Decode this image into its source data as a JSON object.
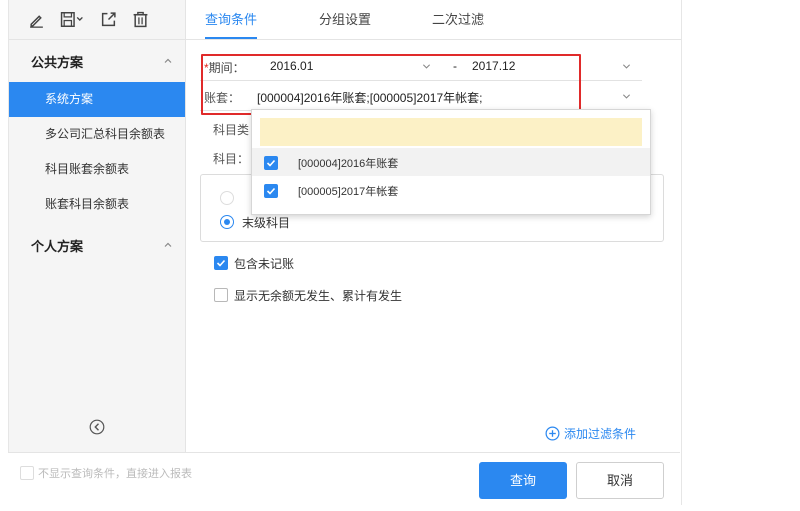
{
  "toolbar": {
    "icons": [
      "edit-icon",
      "save-icon",
      "export-icon",
      "delete-icon"
    ]
  },
  "sidebar": {
    "public_title": "公共方案",
    "public_items": [
      "系统方案",
      "多公司汇总科目余额表",
      "科目账套余额表",
      "账套科目余额表"
    ],
    "private_title": "个人方案"
  },
  "tabs": [
    "查询条件",
    "分组设置",
    "二次过滤"
  ],
  "form": {
    "period_required": "*",
    "period_label": "期间：",
    "period_from": "2016.01",
    "period_sep": "-",
    "period_to": "2017.12",
    "book_label": "账套：",
    "book_value": "[000004]2016年账套;[000005]2017年帐套;",
    "subject_type_label": "科目类",
    "subject_label": "科目：",
    "radio_leaf": "末级科目",
    "include_unposted": "包含未记账",
    "show_no_balance": "显示无余额无发生、累计有发生"
  },
  "dropdown": {
    "items": [
      "[000004]2016年账套",
      "[000005]2017年帐套"
    ]
  },
  "add_filter": "添加过滤条件",
  "footer": {
    "skip_text": "不显示查询条件，直接进入报表",
    "query_button": "查询",
    "cancel_button": "取消"
  },
  "colors": {
    "accent": "#2b88f0",
    "highlight_red": "#e02a2a",
    "search_bg": "#fcf1c6"
  }
}
